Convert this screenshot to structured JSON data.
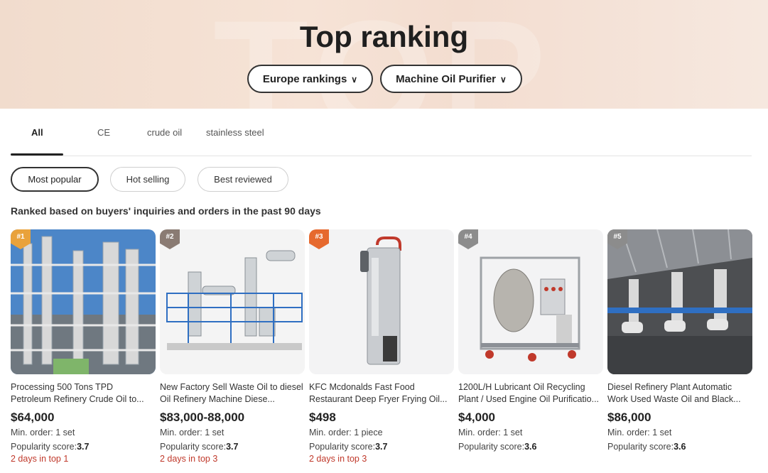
{
  "hero": {
    "title": "Top ranking",
    "region_select": "Europe rankings",
    "category_select": "Machine Oil Purifier"
  },
  "tabs": [
    "All",
    "CE",
    "crude oil",
    "stainless steel"
  ],
  "sort_options": [
    "Most popular",
    "Hot selling",
    "Best reviewed"
  ],
  "ranking_note": "Ranked based on buyers' inquiries and orders in the past 90 days",
  "labels": {
    "popularity_prefix": "Popularity score:"
  },
  "colors": {
    "rank1": "#e9a23b",
    "rank2": "#8a7b73",
    "rank3": "#e6692e",
    "rank_other": "#8c8c8c",
    "days_text": "#c0392b"
  },
  "products": [
    {
      "rank": "#1",
      "title": "Processing 500 Tons TPD Petroleum Refinery Crude Oil to...",
      "price": "$64,000",
      "min_order": "Min. order: 1 set",
      "score": "3.7",
      "days": "2 days in top 1",
      "image": "refinery-tower-photo"
    },
    {
      "rank": "#2",
      "title": "New Factory Sell Waste Oil to diesel Oil Refinery Machine Diese...",
      "price": "$83,000-88,000",
      "min_order": "Min. order: 1 set",
      "score": "3.7",
      "days": "2 days in top 3",
      "image": "blue-refinery-plant-photo"
    },
    {
      "rank": "#3",
      "title": "KFC Mcdonalds Fast Food Restaurant Deep Fryer Frying Oil...",
      "price": "$498",
      "min_order": "Min. order: 1 piece",
      "score": "3.7",
      "days": "2 days in top 3",
      "image": "fryer-oil-filter-photo"
    },
    {
      "rank": "#4",
      "title": "1200L/H Lubricant Oil Recycling Plant / Used Engine Oil Purificatio...",
      "price": "$4,000",
      "min_order": "Min. order: 1 set",
      "score": "3.6",
      "days": "",
      "image": "oil-purifier-cart-photo"
    },
    {
      "rank": "#5",
      "title": "Diesel Refinery Plant Automatic Work Used Waste Oil and Black...",
      "price": "$86,000",
      "min_order": "Min. order: 1 set",
      "score": "3.6",
      "days": "",
      "image": "factory-hall-refinery-photo"
    }
  ]
}
